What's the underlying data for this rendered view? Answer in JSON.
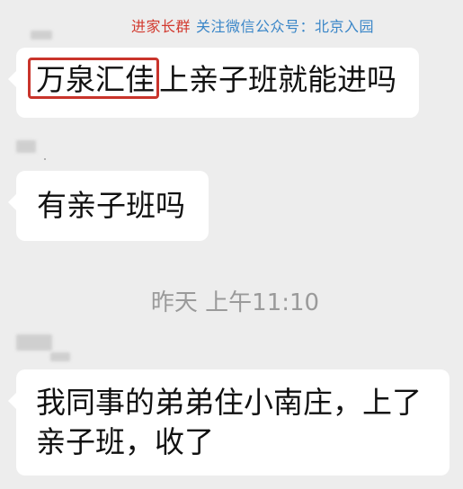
{
  "banner": {
    "red_text": "进家长群",
    "blue_text": "关注微信公众号：北京入园"
  },
  "messages": [
    {
      "highlighted": "万泉汇佳",
      "text_after": "上亲子班就能进吗"
    },
    {
      "text": "有亲子班吗"
    },
    {
      "lines": [
        "我同事的弟弟住小南庄，上了",
        "亲子班，收了"
      ]
    }
  ],
  "timestamp": "昨天 上午11:10",
  "colors": {
    "background": "#ededed",
    "bubble": "#ffffff",
    "highlight_border": "#c9342b",
    "banner_red": "#d23a2f",
    "banner_blue": "#3a86c8",
    "timestamp": "#9a9a9a"
  }
}
